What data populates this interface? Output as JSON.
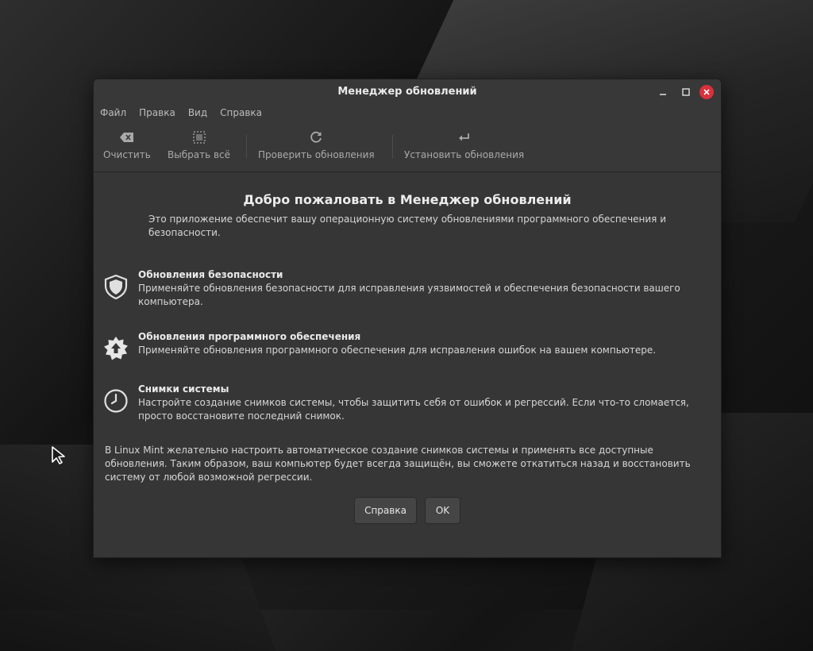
{
  "window": {
    "title": "Менеджер обновлений"
  },
  "menu": [
    "Файл",
    "Правка",
    "Вид",
    "Справка"
  ],
  "toolbar": {
    "clear": "Очистить",
    "select_all": "Выбрать всё",
    "check_updates": "Проверить обновления",
    "install_updates": "Установить обновления"
  },
  "welcome": {
    "title": "Добро пожаловать в Менеджер обновлений",
    "description": "Это приложение обеспечит вашу операционную систему обновлениями программного обеспечения и безопасности."
  },
  "features": [
    {
      "icon": "shield-icon",
      "title": "Обновления безопасности",
      "description": "Применяйте обновления безопасности для исправления уязвимостей и обеспечения безопасности вашего компьютера."
    },
    {
      "icon": "software-update-icon",
      "title": "Обновления программного обеспечения",
      "description": "Применяйте обновления программного обеспечения для исправления ошибок на вашем компьютере."
    },
    {
      "icon": "clock-icon",
      "title": "Снимки системы",
      "description": "Настройте создание снимков системы, чтобы защитить себя от ошибок и регрессий. Если что-то сломается, просто восстановите последний снимок."
    }
  ],
  "footer_text": "В Linux Mint желательно настроить автоматическое создание снимков системы и применять все доступные обновления. Таким образом, ваш компьютер будет всегда защищён, вы сможете откатиться назад и восстановить систему от любой возможной регрессии.",
  "buttons": {
    "help": "Справка",
    "ok": "OK"
  },
  "colors": {
    "close_button": "#d8313b",
    "window_bg": "#383838"
  }
}
